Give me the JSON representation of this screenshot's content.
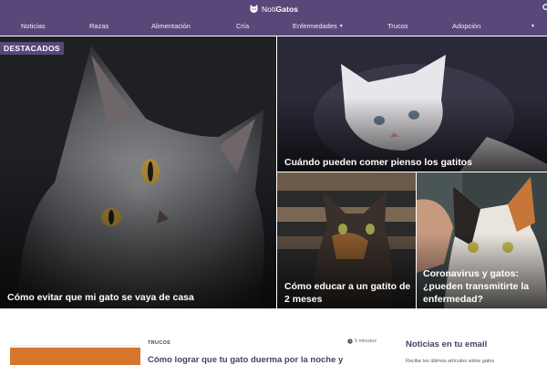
{
  "header": {
    "logo_prefix": "Noti",
    "logo_bold": "Gatos",
    "brand_color": "#584879",
    "search_icon": "search-icon"
  },
  "nav": {
    "items": [
      {
        "label": "Noticias"
      },
      {
        "label": "Razas"
      },
      {
        "label": "Alimentación"
      },
      {
        "label": "Cría"
      },
      {
        "label": "Enfermedades",
        "dropdown": "▾"
      },
      {
        "label": "Trucos"
      },
      {
        "label": "Adopción"
      }
    ],
    "more": "▾"
  },
  "featured": {
    "badge": "DESTACADOS",
    "items": [
      {
        "title": "Cómo evitar que mi gato se vaya de casa"
      },
      {
        "title": "Cuándo pueden comer pienso los gatitos"
      },
      {
        "title": "Cómo educar a un gatito de 2 meses"
      },
      {
        "title": "Coronavirus y gatos: ¿pueden transmitirte la enfermedad?"
      }
    ]
  },
  "latest": {
    "tag": "TRUCOS",
    "read_time": "5 minutos",
    "title": "Cómo lograr que tu gato duerma por la noche y"
  },
  "sidebar": {
    "title": "Noticias en tu email",
    "text": "Recibe los últimos artículos sobre gatos"
  }
}
